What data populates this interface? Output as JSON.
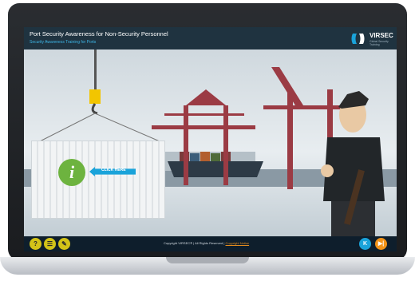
{
  "header": {
    "title": "Port Security Awareness for Non-Security Personnel",
    "subtitle": "Security Awareness Training for Ports",
    "brand_name": "VIRSEC",
    "brand_tagline": "Global Security Training"
  },
  "scene": {
    "click_here_label": "CLICK HERE",
    "info_icon": "i"
  },
  "footer": {
    "copyright": "Copyright VIRSEC® | All Rights Reserved |",
    "terms_link": "Copyright Notice",
    "controls": [
      {
        "icon": "help-icon",
        "glyph": "?"
      },
      {
        "icon": "menu-list-icon",
        "glyph": "☰"
      },
      {
        "icon": "pencil-notes-icon",
        "glyph": "✎"
      }
    ],
    "prev_glyph": "K",
    "next_glyph": "▶|"
  },
  "colors": {
    "title_bar": "#1f3340",
    "footer_bar": "#0e1e2c",
    "accent_cyan": "#1aa3da",
    "info_green": "#6db33f",
    "control_yellow": "#d2c318",
    "nav_next_orange": "#f29318",
    "crane_red": "#9b3b44"
  }
}
